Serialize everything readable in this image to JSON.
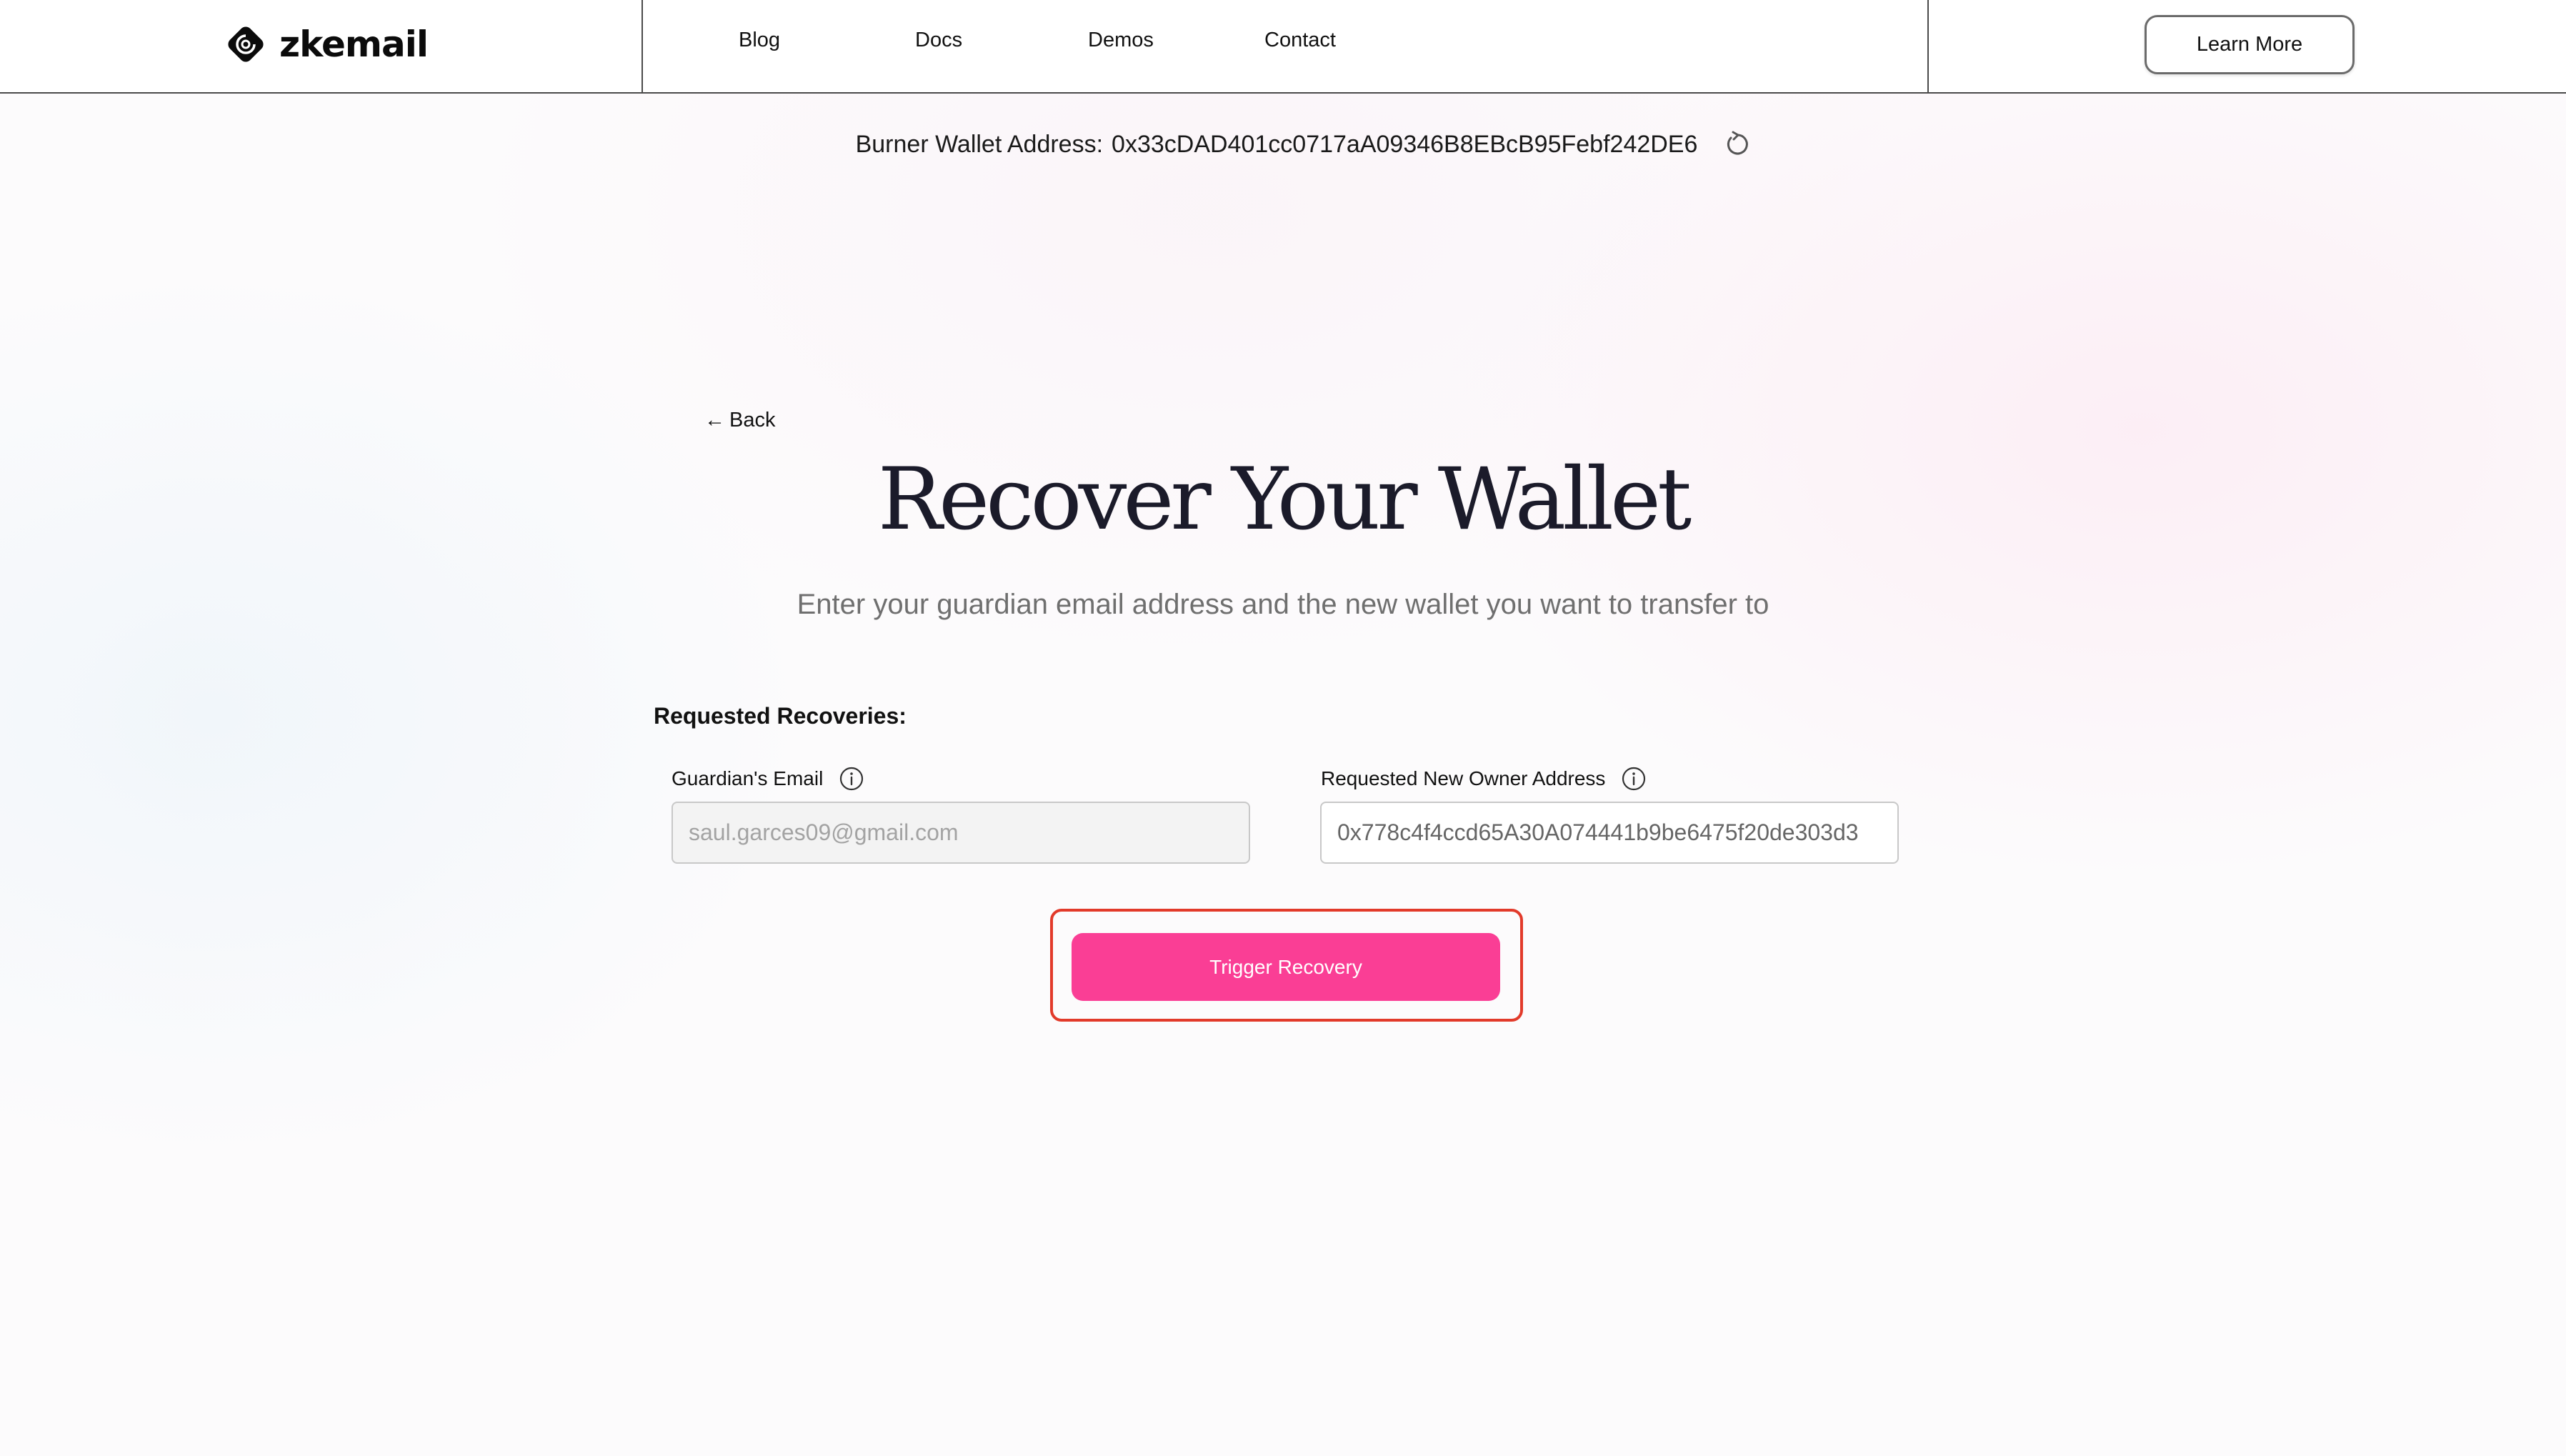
{
  "header": {
    "brand": "zkemail",
    "nav": [
      "Blog",
      "Docs",
      "Demos",
      "Contact"
    ],
    "cta": "Learn More"
  },
  "burner": {
    "label": "Burner Wallet Address:",
    "address": "0x33cDAD401cc0717aA09346B8EBcB95Febf242DE6",
    "refresh_icon": "refresh-icon"
  },
  "main": {
    "back": "Back",
    "title": "Recover Your Wallet",
    "subtitle": "Enter your guardian email address and the new wallet you want to transfer to",
    "section_heading": "Requested Recoveries:",
    "email": {
      "label": "Guardian's Email",
      "value": "saul.garces09@gmail.com",
      "icon": "info-icon"
    },
    "address": {
      "label": "Requested New Owner Address",
      "value": "0x778c4f4ccd65A30A074441b9be6475f20de303d3",
      "icon": "info-icon"
    },
    "trigger": "Trigger Recovery"
  },
  "colors": {
    "accent": "#fa3e95",
    "highlight_outline": "#e23a2a"
  }
}
